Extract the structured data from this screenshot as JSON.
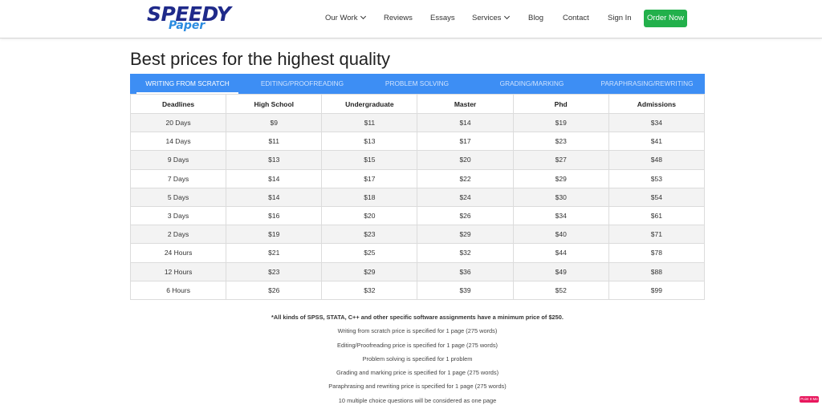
{
  "brand": {
    "main": "SPEEDY",
    "sub": "Paper"
  },
  "nav": {
    "our_work": "Our Work",
    "reviews": "Reviews",
    "essays": "Essays",
    "services": "Services",
    "blog": "Blog",
    "contact": "Contact",
    "sign_in": "Sign In",
    "order_now": "Order Now"
  },
  "page_title": "Best prices for the highest quality",
  "tabs": [
    {
      "label": "WRITING FROM SCRATCH",
      "active": true
    },
    {
      "label": "EDITING/PROOFREADING",
      "active": false
    },
    {
      "label": "PROBLEM SOLVING",
      "active": false
    },
    {
      "label": "GRADING/MARKING",
      "active": false
    },
    {
      "label": "PARAPHRASING/REWRITING",
      "active": false
    }
  ],
  "table": {
    "headers": [
      "Deadlines",
      "High School",
      "Undergraduate",
      "Master",
      "Phd",
      "Admissions"
    ],
    "rows": [
      [
        "20 Days",
        "$9",
        "$11",
        "$14",
        "$19",
        "$34"
      ],
      [
        "14 Days",
        "$11",
        "$13",
        "$17",
        "$23",
        "$41"
      ],
      [
        "9 Days",
        "$13",
        "$15",
        "$20",
        "$27",
        "$48"
      ],
      [
        "7 Days",
        "$14",
        "$17",
        "$22",
        "$29",
        "$53"
      ],
      [
        "5 Days",
        "$14",
        "$18",
        "$24",
        "$30",
        "$54"
      ],
      [
        "3 Days",
        "$16",
        "$20",
        "$26",
        "$34",
        "$61"
      ],
      [
        "2 Days",
        "$19",
        "$23",
        "$29",
        "$40",
        "$71"
      ],
      [
        "24 Hours",
        "$21",
        "$25",
        "$32",
        "$44",
        "$78"
      ],
      [
        "12 Hours",
        "$23",
        "$29",
        "$36",
        "$49",
        "$88"
      ],
      [
        "6 Hours",
        "$26",
        "$32",
        "$39",
        "$52",
        "$99"
      ]
    ]
  },
  "notes": {
    "software": "*All kinds of SPSS, STATA, C++ and other specific software assignments have a minimum price of $250.",
    "writing": "Writing from scratch price is specified for 1 page (275 words)",
    "editing": "Editing/Proofreading price is specified for 1 page (275 words)",
    "problem": "Problem solving is specified for 1 problem",
    "grading": "Grading and marking price is specified for 1 page (275 words)",
    "paraphrasing": "Paraphrasing and rewriting price is specified for 1 page (275 words)",
    "multiple_choice": "10 multiple choice questions will be considered as one page"
  },
  "badge": "Point It Me",
  "colors": {
    "brand": "#1f2a8a",
    "brand_sub": "#2a8be0",
    "tab_bar": "#3d8ef4",
    "order_button": "#22b04b",
    "badge": "#e8175d"
  }
}
